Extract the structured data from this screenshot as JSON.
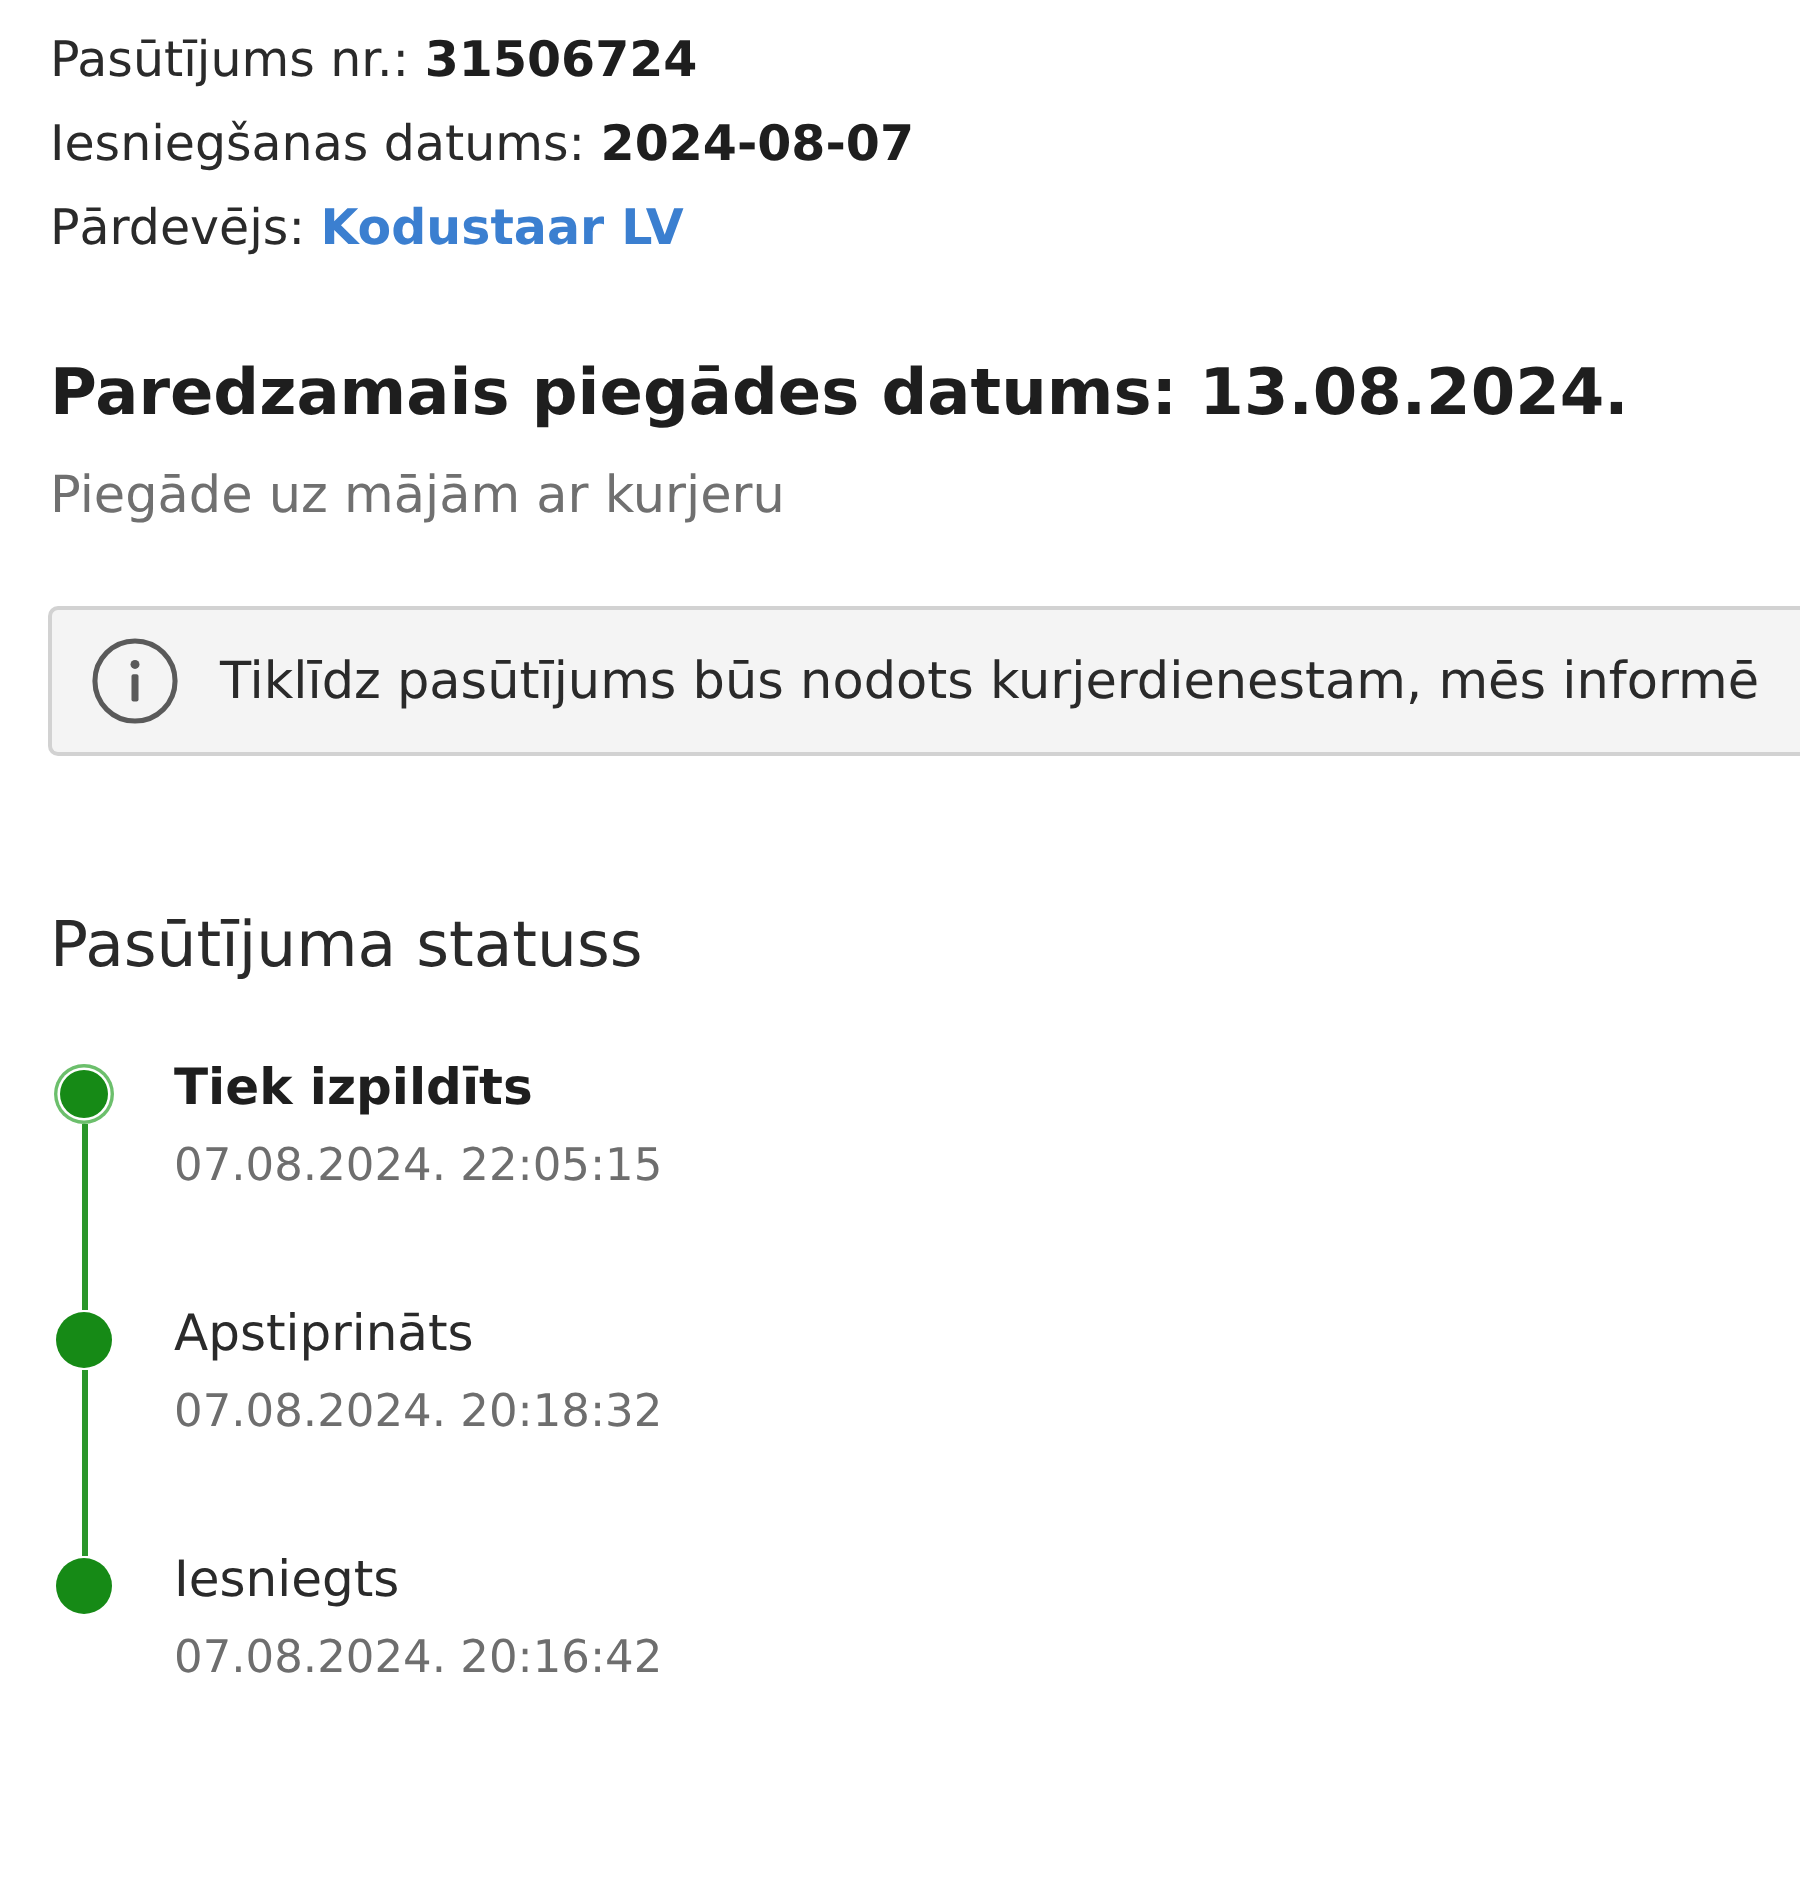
{
  "order": {
    "fields": [
      {
        "kind": "text",
        "label": "Pasūtījums nr.:",
        "value": "31506724"
      },
      {
        "kind": "text",
        "label": "Iesniegšanas datums:",
        "value": "2024-08-07"
      },
      {
        "kind": "link",
        "label": "Pārdevējs:",
        "value": "Kodustaar LV"
      }
    ]
  },
  "delivery": {
    "title": "Paredzamais piegādes datums: 13.08.2024.",
    "method": "Piegāde uz mājām ar kurjeru"
  },
  "notice": {
    "text": "Tiklīdz pasūtījums būs nodots kurjerdienestam, mēs informē"
  },
  "status": {
    "title": "Pasūtījuma statuss",
    "steps": [
      {
        "title": "Tiek izpildīts",
        "time": "07.08.2024. 22:05:15",
        "current": true
      },
      {
        "title": "Apstiprināts",
        "time": "07.08.2024. 20:18:32",
        "current": false
      },
      {
        "title": "Iesniegts",
        "time": "07.08.2024. 20:16:42",
        "current": false
      }
    ]
  }
}
